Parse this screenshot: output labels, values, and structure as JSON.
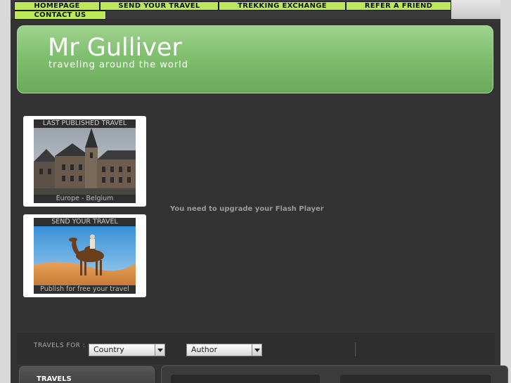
{
  "nav": {
    "homepage": "HOMEPAGE",
    "send_your_travel": "SEND YOUR TRAVEL",
    "trekking_exchange": "TREKKING EXCHANGE",
    "refer_a_friend": "REFER A FRIEND",
    "contact_us": "CONTACT US"
  },
  "header": {
    "title": "Mr Gulliver",
    "subtitle": "traveling around the world"
  },
  "cards": {
    "last_published": {
      "title": "LAST PUBLISHED TRAVEL",
      "caption": "Europe - Belgium"
    },
    "send_travel": {
      "title": "SEND YOUR TRAVEL",
      "caption": "Publish for free your travel"
    }
  },
  "flash": {
    "message": "You need to upgrade your Flash Player"
  },
  "search": {
    "label": "TRAVELS FOR :",
    "country_value": "Country",
    "author_value": "Author"
  },
  "sections": {
    "travels": "TRAVELS"
  },
  "colors": {
    "nav_bg": "#bde85a",
    "header_green": "#7fbf6e",
    "page_bg": "#333333"
  }
}
